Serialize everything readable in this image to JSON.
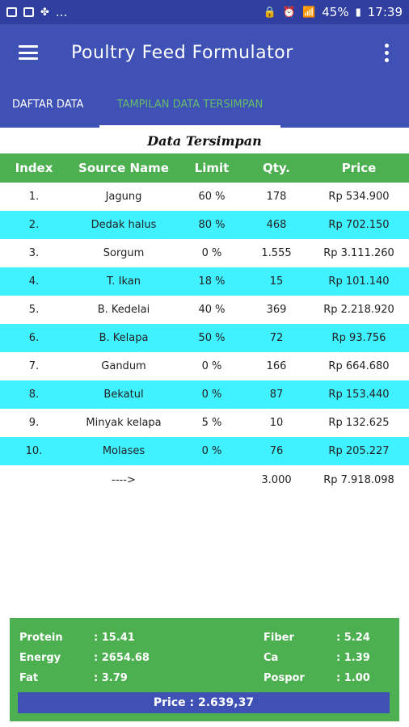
{
  "status_bar": {
    "left_more": "...",
    "battery_percent": "45%",
    "time": "17:39"
  },
  "app_bar": {
    "title": "Poultry Feed Formulator"
  },
  "tabs": [
    {
      "label": "DAFTAR DATA",
      "active": false
    },
    {
      "label": "TAMPILAN DATA TERSIMPAN",
      "active": true
    }
  ],
  "table_title": "Data Tersimpan",
  "columns": [
    "Index",
    "Source Name",
    "Limit",
    "Qty.",
    "Price"
  ],
  "rows": [
    {
      "index": "1.",
      "name": "Jagung",
      "limit": "60 %",
      "qty": "178",
      "price": "Rp 534.900"
    },
    {
      "index": "2.",
      "name": "Dedak halus",
      "limit": "80 %",
      "qty": "468",
      "price": "Rp 702.150"
    },
    {
      "index": "3.",
      "name": "Sorgum",
      "limit": "0 %",
      "qty": "1.555",
      "price": "Rp 3.111.260"
    },
    {
      "index": "4.",
      "name": "T. Ikan",
      "limit": "18 %",
      "qty": "15",
      "price": "Rp 101.140"
    },
    {
      "index": "5.",
      "name": "B. Kedelai",
      "limit": "40 %",
      "qty": "369",
      "price": "Rp 2.218.920"
    },
    {
      "index": "6.",
      "name": "B. Kelapa",
      "limit": "50 %",
      "qty": "72",
      "price": "Rp 93.756"
    },
    {
      "index": "7.",
      "name": "Gandum",
      "limit": "0 %",
      "qty": "166",
      "price": "Rp 664.680"
    },
    {
      "index": "8.",
      "name": "Bekatul",
      "limit": "0 %",
      "qty": "87",
      "price": "Rp 153.440"
    },
    {
      "index": "9.",
      "name": "Minyak kelapa",
      "limit": "5 %",
      "qty": "10",
      "price": "Rp 132.625"
    },
    {
      "index": "10.",
      "name": "Molases",
      "limit": "0 %",
      "qty": "76",
      "price": "Rp 205.227"
    }
  ],
  "totals": {
    "arrow": "---->",
    "qty": "3.000",
    "price": "Rp 7.918.098"
  },
  "summary": {
    "protein_label": "Protein",
    "protein_value": ": 15.41",
    "energy_label": "Energy",
    "energy_value": ": 2654.68",
    "fat_label": "Fat",
    "fat_value": ": 3.79",
    "fiber_label": "Fiber",
    "fiber_value": ": 5.24",
    "ca_label": "Ca",
    "ca_value": ": 1.39",
    "pospor_label": "Pospor",
    "pospor_value": ": 1.00",
    "price_label": "Price : 2.639,37"
  },
  "colors": {
    "primary": "#3f51b5",
    "primary_dark": "#303f9f",
    "header_green": "#4caf50",
    "row_cyan": "#40f2ff",
    "active_tab_text": "#66bb6a"
  }
}
